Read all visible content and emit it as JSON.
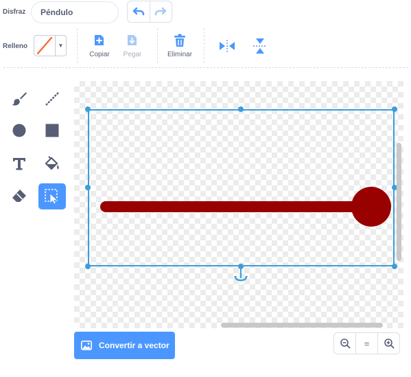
{
  "costume": {
    "label": "Disfraz",
    "name_value": "Péndulo"
  },
  "history": {
    "undo_icon": "undo-icon",
    "redo_icon": "redo-icon"
  },
  "fill": {
    "label": "Relleno",
    "color": "#ff6633",
    "dropdown_glyph": "▼"
  },
  "edit_tools": [
    {
      "label": "Copiar",
      "icon": "copy-icon",
      "enabled": true
    },
    {
      "label": "Pegar",
      "icon": "paste-icon",
      "enabled": false
    },
    {
      "label": "Eliminar",
      "icon": "trash-icon",
      "enabled": true
    }
  ],
  "flip_tools": [
    {
      "icon": "flip-horizontal-icon"
    },
    {
      "icon": "flip-vertical-icon"
    }
  ],
  "palette": [
    {
      "name": "brush",
      "icon": "brush-icon",
      "selected": false
    },
    {
      "name": "line",
      "icon": "line-icon",
      "selected": false
    },
    {
      "name": "circle",
      "icon": "circle-icon",
      "selected": false
    },
    {
      "name": "rectangle",
      "icon": "rectangle-icon",
      "selected": false
    },
    {
      "name": "text",
      "icon": "text-icon",
      "selected": false
    },
    {
      "name": "fill",
      "icon": "fill-bucket-icon",
      "selected": false
    },
    {
      "name": "eraser",
      "icon": "eraser-icon",
      "selected": false
    },
    {
      "name": "select",
      "icon": "select-icon",
      "selected": true
    }
  ],
  "drawing": {
    "pendulum_color": "#990000",
    "selection_color": "#3d9ddb"
  },
  "convert": {
    "label": "Convertir a vector",
    "icon": "image-icon"
  },
  "zoom": {
    "out_icon": "zoom-out-icon",
    "reset_label": "=",
    "in_icon": "zoom-in-icon"
  },
  "colors": {
    "accent": "#4c97ff",
    "text": "#575e75"
  }
}
